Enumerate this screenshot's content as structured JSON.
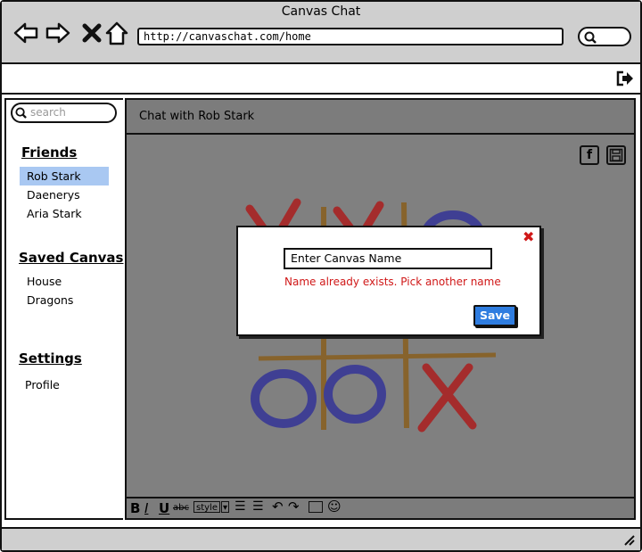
{
  "window": {
    "title": "Canvas Chat"
  },
  "browser": {
    "url": "http://canvaschat.com/home"
  },
  "sidebar": {
    "search_placeholder": "search",
    "friends": {
      "heading": "Friends",
      "items": [
        "Rob Stark",
        "Daenerys",
        "Aria Stark"
      ],
      "active_index": 0
    },
    "saved_canvas": {
      "heading": "Saved Canvas",
      "items": [
        "House",
        "Dragons"
      ]
    },
    "settings": {
      "heading": "Settings",
      "items": [
        "Profile"
      ]
    }
  },
  "chat": {
    "header": "Chat with Rob Stark",
    "share_icon": "facebook-icon",
    "save_icon": "floppy-disk-icon"
  },
  "editor_toolbar": {
    "bold": "B",
    "italic": "I",
    "underline": "U",
    "strike": "abc",
    "style_label": "style"
  },
  "dialog": {
    "input_value": "Enter Canvas Name",
    "error": "Name already exists. Pick another name",
    "save_label": "Save",
    "close_icon": "close-icon"
  },
  "colors": {
    "accent": "#2f7de0",
    "error": "#d01818",
    "selection": "#a9c8f2"
  }
}
